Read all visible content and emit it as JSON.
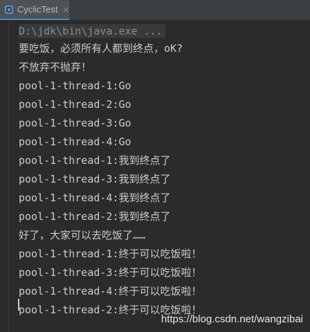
{
  "tab": {
    "title": "CyclicTest",
    "close_glyph": "×",
    "icon": "run-config-icon"
  },
  "console": {
    "lines": [
      "D:\\jdk\\bin\\java.exe ...",
      "要吃饭，必须所有人都到终点，oK?",
      "不放弃不抛弃！",
      "pool-1-thread-1:Go",
      "pool-1-thread-2:Go",
      "pool-1-thread-3:Go",
      "pool-1-thread-4:Go",
      "pool-1-thread-1:我到终点了",
      "pool-1-thread-3:我到终点了",
      "pool-1-thread-4:我到终点了",
      "pool-1-thread-2:我到终点了",
      "好了，大家可以去吃饭了……",
      "pool-1-thread-1:终于可以吃饭啦！",
      "pool-1-thread-3:终于可以吃饭啦！",
      "pool-1-thread-4:终于可以吃饭啦！",
      "pool-1-thread-2:终于可以吃饭啦！"
    ]
  },
  "watermark": "https://blog.csdn.net/wangzibai",
  "colors": {
    "background": "#2b2b2b",
    "text": "#cccccc",
    "command": "#8c8c8c",
    "tab_accent": "#4a88c7"
  }
}
